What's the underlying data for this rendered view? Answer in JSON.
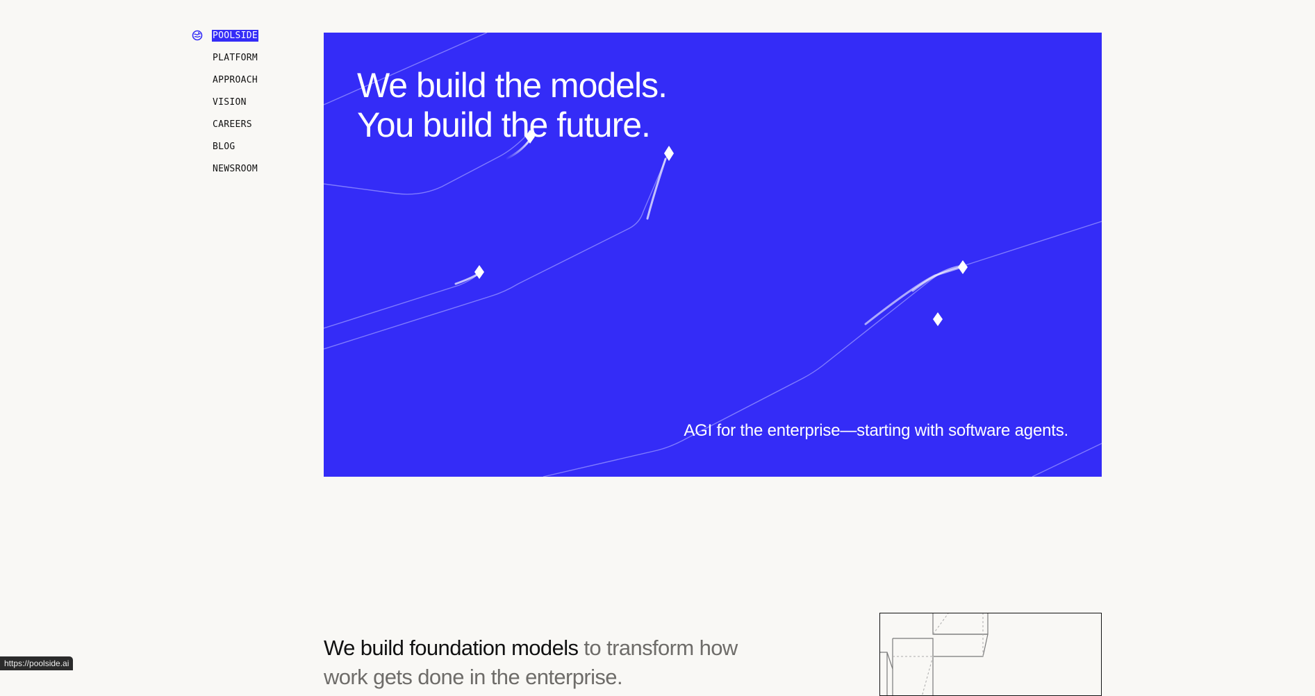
{
  "nav": {
    "items": [
      {
        "label": "POOLSIDE",
        "active": true
      },
      {
        "label": "PLATFORM",
        "active": false
      },
      {
        "label": "APPROACH",
        "active": false
      },
      {
        "label": "VISION",
        "active": false
      },
      {
        "label": "CAREERS",
        "active": false
      },
      {
        "label": "BLOG",
        "active": false
      },
      {
        "label": "NEWSROOM",
        "active": false
      }
    ]
  },
  "hero": {
    "title_line1": "We build the models.",
    "title_line2": "You build the future.",
    "tagline": "AGI for the enterprise—starting with software agents.",
    "background_color": "#342cf7"
  },
  "intro": {
    "text_strong": "We build foundation models",
    "text_muted": " to transform how work gets done in the enterprise."
  },
  "status_bar": {
    "url": "https://poolside.ai"
  },
  "colors": {
    "accent": "#342cf7",
    "page_background": "#f9f8f5",
    "muted_text": "#6e6c69"
  }
}
